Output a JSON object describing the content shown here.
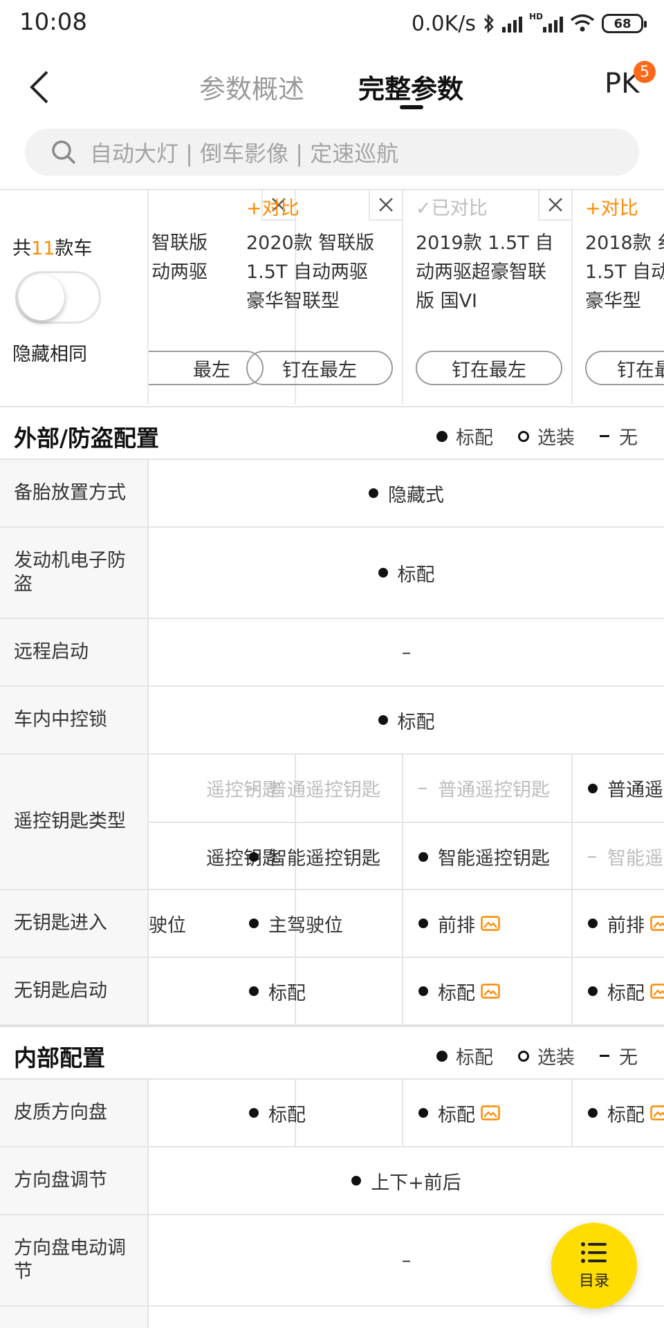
{
  "status_bar": {
    "time": "10:08",
    "network_speed": "0.0K/s",
    "hd_label": "HD",
    "battery": "68"
  },
  "nav": {
    "tab_overview": "参数概述",
    "tab_full": "完整参数",
    "pk_label": "PK",
    "pk_badge": "5"
  },
  "search": {
    "placeholder": "自动大灯 | 倒车影像 | 定速巡航"
  },
  "header": {
    "count_prefix": "共",
    "count": "11",
    "count_suffix": "款车",
    "hide_same_label": "隐藏相同",
    "cars": [
      {
        "name": "智联版\n动两驱",
        "compare_label": "",
        "pin_label": "最左"
      },
      {
        "name": "2020款 智联版\n1.5T 自动两驱\n豪华智联型",
        "compare_label": "+对比",
        "pin_label": "钉在最左"
      },
      {
        "name": "2019款 1.5T 自\n动两驱超豪智联\n版 国VI",
        "compare_label": "✓已对比",
        "pin_label": "钉在最左"
      },
      {
        "name": "2018款 纟\n1.5T 自动\n豪华型",
        "compare_label": "+对比",
        "pin_label": "钉在最"
      }
    ]
  },
  "legend": {
    "standard": "标配",
    "optional": "选装",
    "none": "无"
  },
  "sections": {
    "exterior": "外部/防盗配置",
    "interior": "内部配置"
  },
  "rows": {
    "spare_tire": {
      "label": "备胎放置方式",
      "value": "隐藏式"
    },
    "engine_immobilizer": {
      "label": "发动机电子防盗",
      "value": "标配"
    },
    "remote_start": {
      "label": "远程启动",
      "value": "–"
    },
    "central_lock": {
      "label": "车内中控锁",
      "value": "标配"
    },
    "remote_key": {
      "label": "遥控钥匙类型",
      "line1": [
        "遥控钥匙",
        "普通遥控钥匙",
        "普通遥控钥匙",
        "普通遥"
      ],
      "line2": [
        "遥控钥匙",
        "智能遥控钥匙",
        "智能遥控钥匙",
        "智能遥"
      ]
    },
    "keyless_entry": {
      "label": "无钥匙进入",
      "values": [
        "驶位",
        "主驾驶位",
        "前排",
        "前排"
      ]
    },
    "keyless_start": {
      "label": "无钥匙启动",
      "values": [
        "",
        "标配",
        "标配",
        "标配"
      ]
    },
    "leather_wheel": {
      "label": "皮质方向盘",
      "values": [
        "",
        "标配",
        "标配",
        "标配"
      ]
    },
    "wheel_adjust": {
      "label": "方向盘调节",
      "value": "上下+前后"
    },
    "wheel_power_adjust": {
      "label": "方向盘电动调节",
      "value": "–"
    }
  },
  "fab": {
    "label": "目录"
  },
  "colors": {
    "accent": "#ff8a00",
    "fab": "#ffdd00",
    "badge": "#ff6a1a"
  }
}
